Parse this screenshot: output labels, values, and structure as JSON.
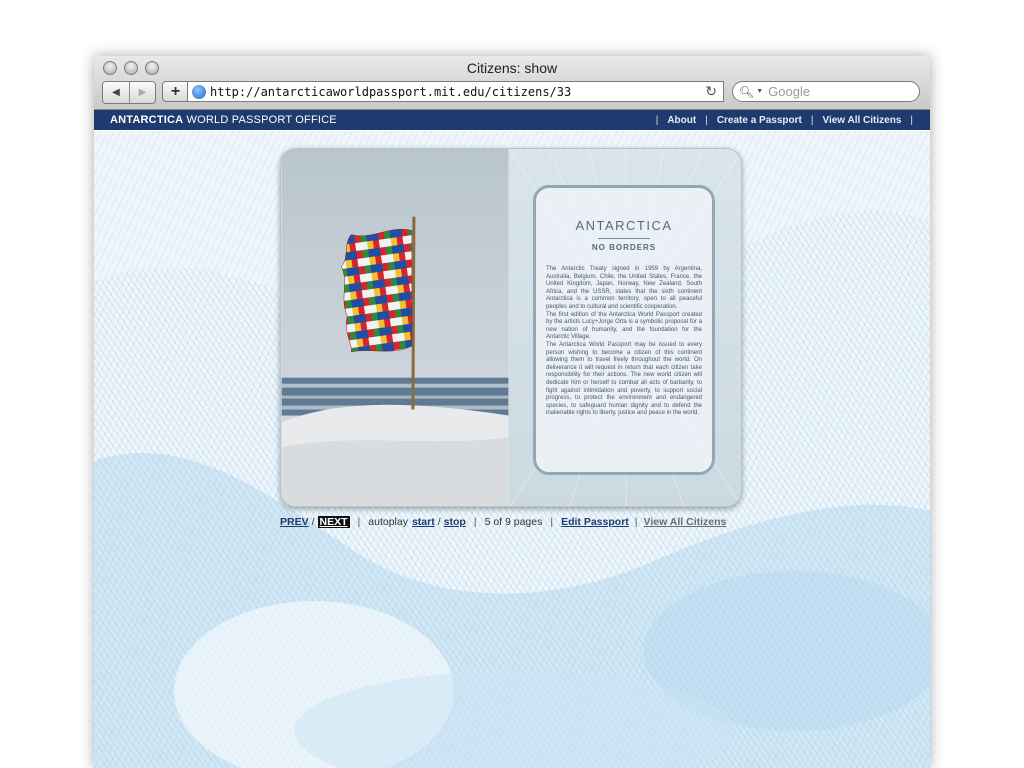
{
  "window": {
    "title": "Citizens: show"
  },
  "toolbar": {
    "back_icon": "back-arrow-icon",
    "forward_icon": "forward-arrow-icon",
    "add_icon": "plus-icon",
    "url": "http://antarcticaworldpassport.mit.edu/citizens/33",
    "search_placeholder": "Google"
  },
  "site": {
    "brand_bold": "ANTARCTICA",
    "brand_rest": " WORLD PASSPORT OFFICE",
    "header_color": "#1f3a6e",
    "nav": [
      {
        "label": "About"
      },
      {
        "label": "Create a Passport"
      },
      {
        "label": "View All Citizens"
      }
    ]
  },
  "passport": {
    "title": "ANTARCTICA",
    "subtitle": "NO BORDERS",
    "paragraphs": [
      "The Antarctic Treaty signed in 1959 by Argentina, Australia, Belgium, Chile, the United States, France, the United Kingdom, Japan, Norway, New Zealand, South Africa, and the USSR, states that the sixth continent Antarctica is a common territory, open to all peaceful peoples and to cultural and scientific cooperation.",
      "The first edition of the Antarctica World Passport created by the artists Lucy+Jorge Orta is a symbolic proposal for a new nation of humanity, and the foundation for the Antarctic Village.",
      "The Antarctica World Passport may be issued to every person wishing to become a citizen of this continent allowing them to travel freely throughout the world. On deliverance it will request in return that each citizen take responsibility for their actions. The new world citizen will dedicate him or herself to combat all acts of barbarity, to fight against intimidation and poverty, to support social progress, to protect the environment and endangered species, to safeguard human dignity and to defend the inalienable rights to liberty, justice and peace in the world."
    ]
  },
  "pager": {
    "prev": "PREV",
    "slash": "/",
    "next": "NEXT",
    "autoplay": "autoplay",
    "start": "start",
    "stop": "stop",
    "page_status": "5 of 9 pages",
    "edit": "Edit Passport",
    "view_all": "View All Citizens"
  }
}
